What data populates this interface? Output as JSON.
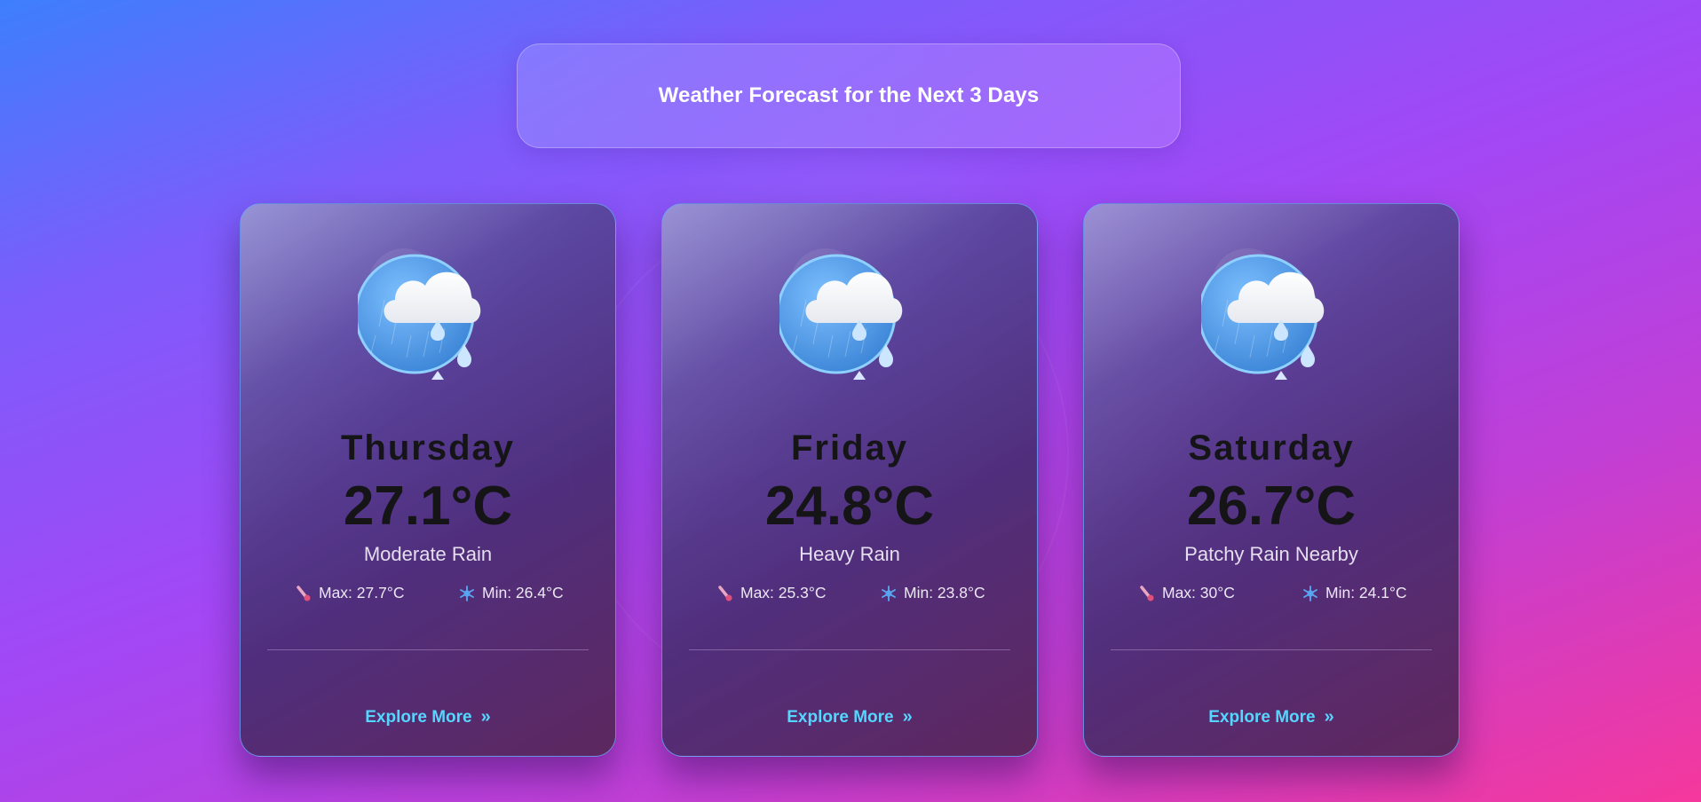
{
  "header": {
    "title": "Weather Forecast for the Next 3 Days"
  },
  "colors": {
    "accent_link": "#56d6ff",
    "thermometer": "#e0507a",
    "snowflake": "#5aa9f5"
  },
  "icons": {
    "weather": "rain-cloud-icon",
    "max": "thermometer-icon",
    "min": "snowflake-icon",
    "explore": "double-chevron-right-icon"
  },
  "forecast": [
    {
      "day": "Thursday",
      "temp": "27.1°C",
      "condition": "Moderate Rain",
      "max": "Max: 27.7°C",
      "min": "Min: 26.4°C",
      "link": "Explore More"
    },
    {
      "day": "Friday",
      "temp": "24.8°C",
      "condition": "Heavy Rain",
      "max": "Max: 25.3°C",
      "min": "Min: 23.8°C",
      "link": "Explore More"
    },
    {
      "day": "Saturday",
      "temp": "26.7°C",
      "condition": "Patchy Rain Nearby",
      "max": "Max: 30°C",
      "min": "Min: 24.1°C",
      "link": "Explore More"
    }
  ]
}
